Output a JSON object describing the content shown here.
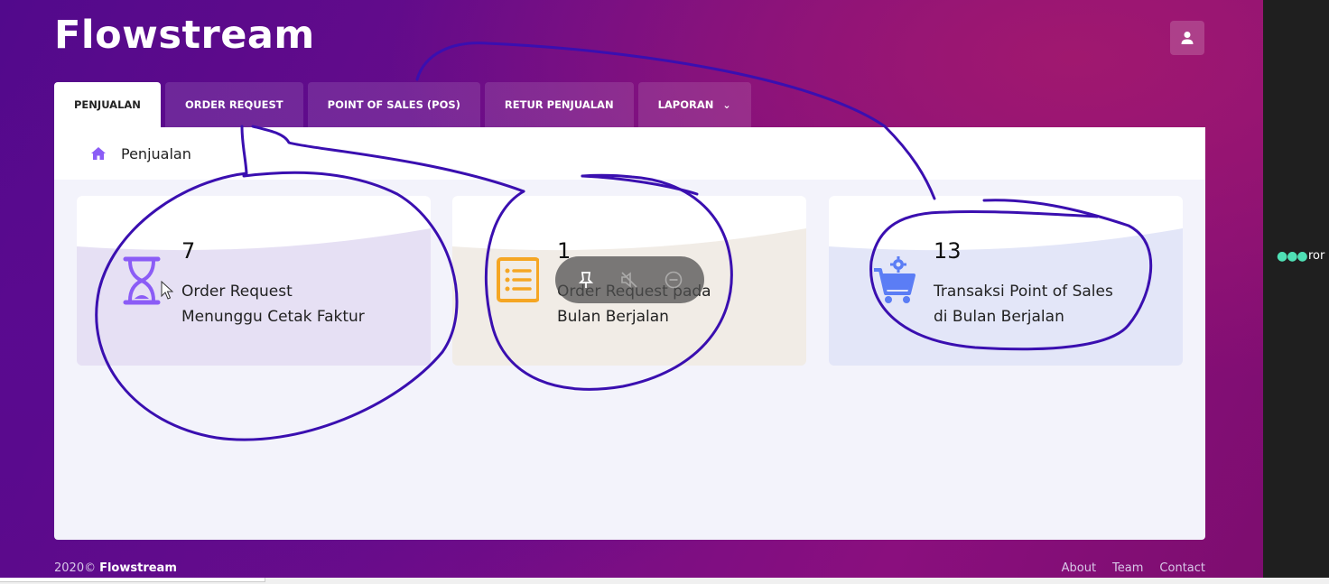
{
  "app": {
    "title": "Flowstream",
    "brand_color": "#6a0c8a"
  },
  "header": {
    "user_icon": "user-icon"
  },
  "tabs": [
    {
      "label": "PENJUALAN",
      "active": true
    },
    {
      "label": "ORDER REQUEST",
      "active": false
    },
    {
      "label": "POINT OF SALES (POS)",
      "active": false
    },
    {
      "label": "RETUR PENJUALAN",
      "active": false
    },
    {
      "label": "LAPORAN",
      "active": false,
      "dropdown": true
    }
  ],
  "breadcrumb": {
    "icon": "home-icon",
    "label": "Penjualan"
  },
  "cards": [
    {
      "count": "7",
      "label_line1": "Order Request",
      "label_line2": "Menunggu Cetak Faktur",
      "icon": "hourglass-icon",
      "color": "#8b5cf6",
      "bg": "#e6e0f4"
    },
    {
      "count": "1",
      "label_line1": "Order Request pada",
      "label_line2": "Bulan Berjalan",
      "icon": "list-icon",
      "color": "#f5a623",
      "bg": "#f1ece6"
    },
    {
      "count": "13",
      "label_line1": "Transaksi Point of Sales",
      "label_line2": "di Bulan Berjalan",
      "icon": "cart-gear-icon",
      "color": "#5b7df5",
      "bg": "#e3e6f8"
    }
  ],
  "footer": {
    "copyright": "2020©",
    "brand": "Flowstream",
    "links": [
      "About",
      "Team",
      "Contact"
    ]
  },
  "side_panel": {
    "text": "ror"
  },
  "media_controls": [
    "pin-icon",
    "mute-icon",
    "minus-circle-icon"
  ]
}
